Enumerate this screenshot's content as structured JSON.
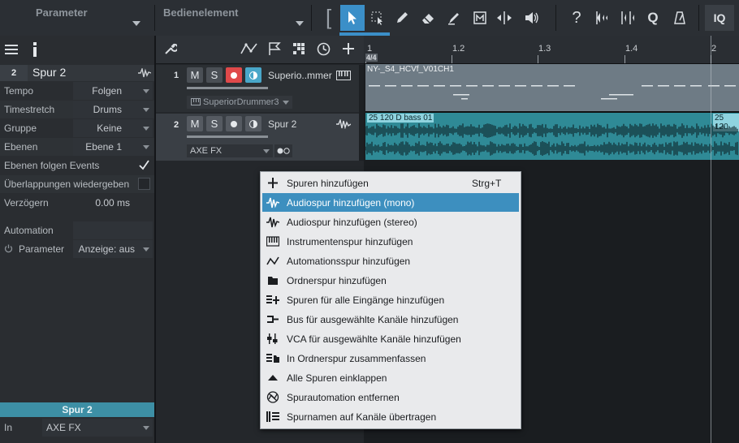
{
  "toolbar": {
    "dropdown_parameter": "Parameter",
    "dropdown_control": "Bedienelement",
    "bracket": "[",
    "help": "?",
    "quantize": "Q",
    "iq": "IQ"
  },
  "inspector": {
    "track_number": "2",
    "track_name": "Spur 2",
    "rows": {
      "tempo": {
        "label": "Tempo",
        "value": "Folgen"
      },
      "timestretch": {
        "label": "Timestretch",
        "value": "Drums"
      },
      "group": {
        "label": "Gruppe",
        "value": "Keine"
      },
      "layers": {
        "label": "Ebenen",
        "value": "Ebene 1"
      },
      "layers_follow": {
        "label": "Ebenen folgen Events",
        "checked": true
      },
      "overlaps": {
        "label": "Überlappungen wiedergeben",
        "checked": false
      },
      "delay": {
        "label": "Verzögern",
        "value": "0.00 ms"
      },
      "automation": {
        "label": "Automation"
      },
      "parameter": {
        "label": "Parameter",
        "value": "Anzeige: aus"
      }
    },
    "bottom": {
      "track_name": "Spur 2",
      "in_label": "In",
      "in_value": "AXE FX"
    }
  },
  "tracks": [
    {
      "number": "1",
      "mute": "M",
      "solo": "S",
      "name": "Superio..mmer",
      "instrument": "SuperiorDrummer3",
      "region": "NY-_S4_HCVf_V01CH1"
    },
    {
      "number": "2",
      "mute": "M",
      "solo": "S",
      "name": "Spur 2",
      "input": "AXE FX",
      "region": "25 120 D bass 01",
      "region2": "25 120"
    }
  ],
  "ruler": {
    "marks": [
      "1",
      "1.2",
      "1.3",
      "1.4",
      "2"
    ],
    "time_signature": "4/4"
  },
  "menu": {
    "items": [
      {
        "label": "Spuren hinzufügen",
        "shortcut": "Strg+T",
        "icon": "plus-icon"
      },
      {
        "label": "Audiospur hinzufügen (mono)",
        "icon": "waveform-icon",
        "selected": true
      },
      {
        "label": "Audiospur hinzufügen (stereo)",
        "icon": "waveform-stereo-icon"
      },
      {
        "label": "Instrumentenspur hinzufügen",
        "icon": "keyboard-icon"
      },
      {
        "label": "Automationsspur hinzufügen",
        "icon": "automation-icon"
      },
      {
        "label": "Ordnerspur hinzufügen",
        "icon": "folder-icon"
      },
      {
        "label": "Spuren für alle Eingänge hinzufügen",
        "icon": "tracks-plus-icon"
      },
      {
        "label": "Bus für ausgewählte Kanäle hinzufügen",
        "icon": "bus-icon"
      },
      {
        "label": "VCA für ausgewählte Kanäle hinzufügen",
        "icon": "vca-icon"
      },
      {
        "label": "In Ordnerspur zusammenfassen",
        "icon": "pack-folder-icon"
      },
      {
        "label": "Alle Spuren einklappen",
        "icon": "collapse-icon"
      },
      {
        "label": "Spurautomation entfernen",
        "icon": "remove-automation-icon"
      },
      {
        "label": "Spurnamen auf Kanäle übertragen",
        "icon": "names-icon"
      }
    ]
  }
}
